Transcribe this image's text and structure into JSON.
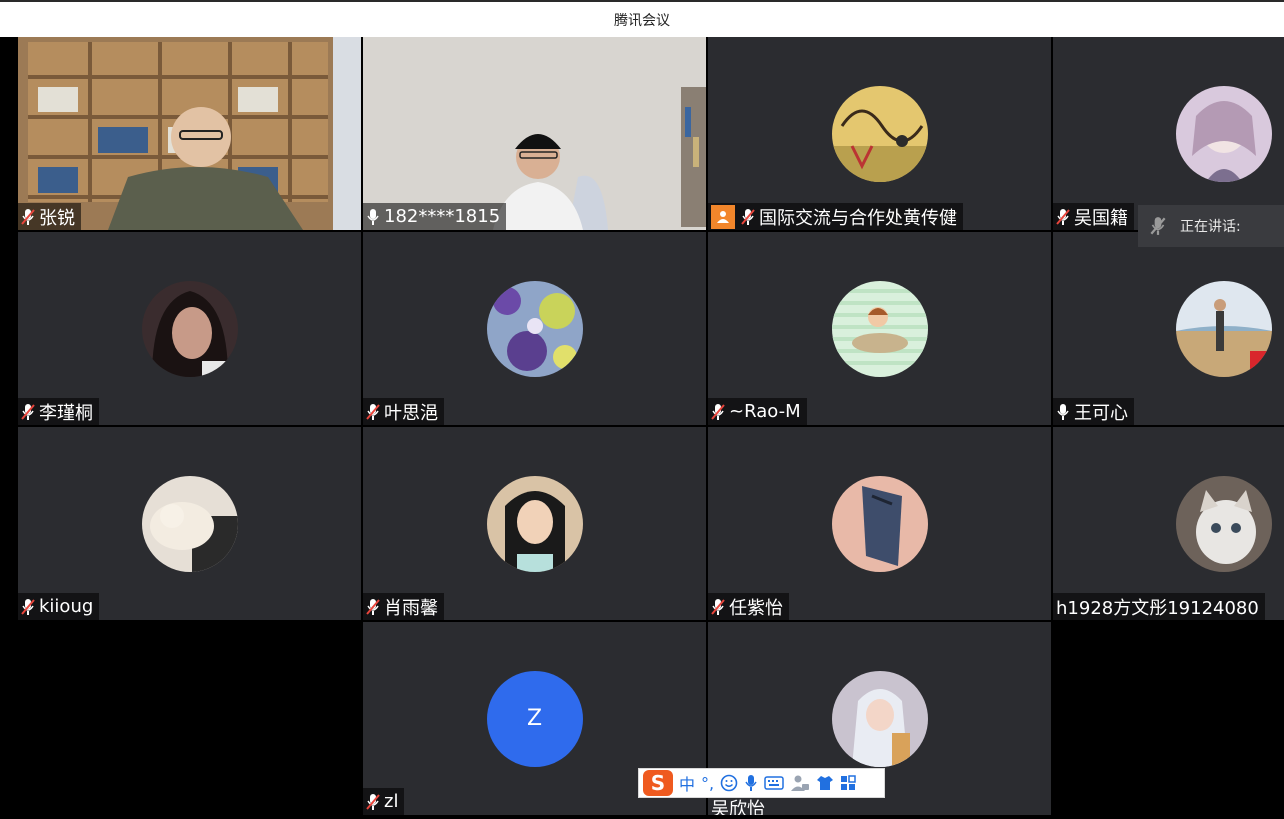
{
  "window": {
    "title": "腾讯会议"
  },
  "participants": [
    {
      "name": "张锐",
      "mic": "muted"
    },
    {
      "name": "182****1815",
      "mic": "on"
    },
    {
      "name": "国际交流与合作处黄传健",
      "mic": "muted",
      "host": true
    },
    {
      "name": "吴国籍",
      "mic": "muted"
    },
    {
      "name": "李瑾桐",
      "mic": "muted"
    },
    {
      "name": "叶思浥",
      "mic": "muted"
    },
    {
      "name": "~Rao-M",
      "mic": "muted"
    },
    {
      "name": "王可心",
      "mic": "on"
    },
    {
      "name": "kiioug",
      "mic": "muted"
    },
    {
      "name": "肖雨馨",
      "mic": "muted"
    },
    {
      "name": "任紫怡",
      "mic": "muted"
    },
    {
      "name": "h1928方文彤19124080",
      "mic": "none"
    },
    {
      "name": "zl",
      "mic": "muted",
      "avatar_letter": "Z"
    },
    {
      "name": "吴欣怡",
      "mic": "muted"
    }
  ],
  "speaking": {
    "label": "正在讲话:"
  },
  "ime": {
    "logo": "S",
    "mode": "中",
    "punct": "°,",
    "icons": [
      "emoji-icon",
      "voice-input-icon",
      "keyboard-icon",
      "user-icon",
      "skin-icon",
      "toolbox-icon"
    ]
  }
}
